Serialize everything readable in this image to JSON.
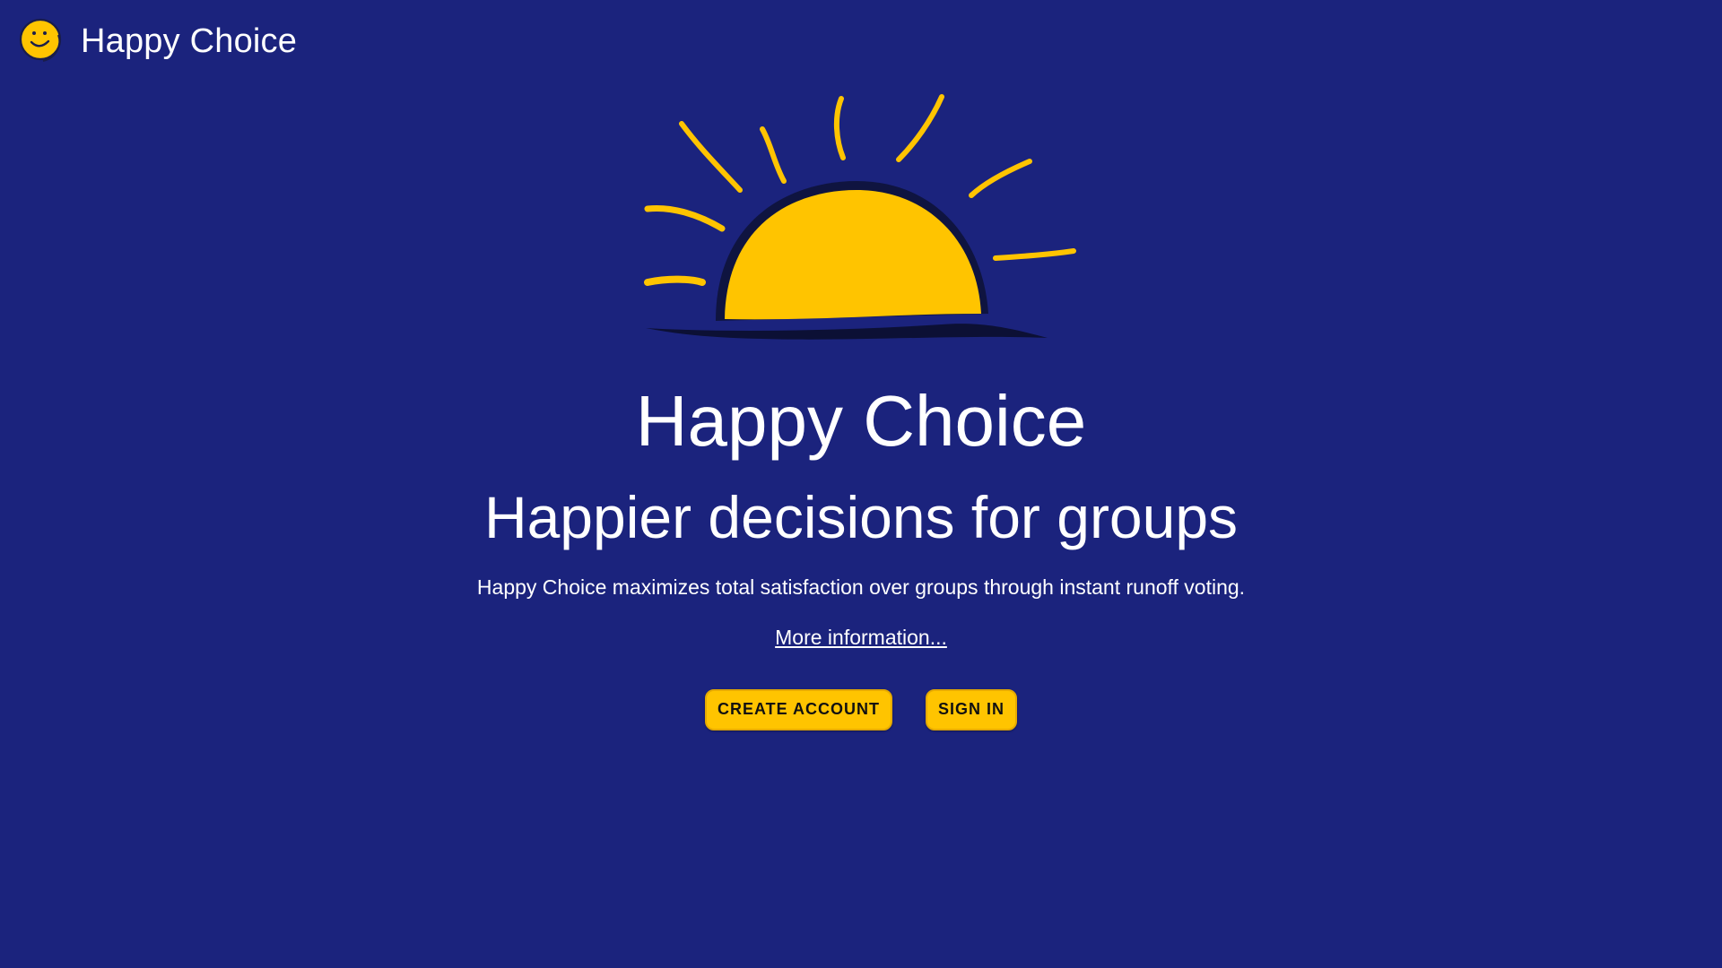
{
  "app": {
    "name": "Happy Choice",
    "logo_icon": "smiley-face-icon"
  },
  "hero": {
    "illustration_icon": "rising-sun-icon",
    "title": "Happy Choice",
    "subtitle": "Happier decisions for groups",
    "description": "Happy Choice maximizes total satisfaction over groups through instant runoff voting.",
    "more_link": "More information..."
  },
  "actions": {
    "create_account": "CREATE ACCOUNT",
    "sign_in": "SIGN IN"
  },
  "colors": {
    "background": "#1b237d",
    "accent": "#ffc400",
    "text": "#ffffff"
  }
}
